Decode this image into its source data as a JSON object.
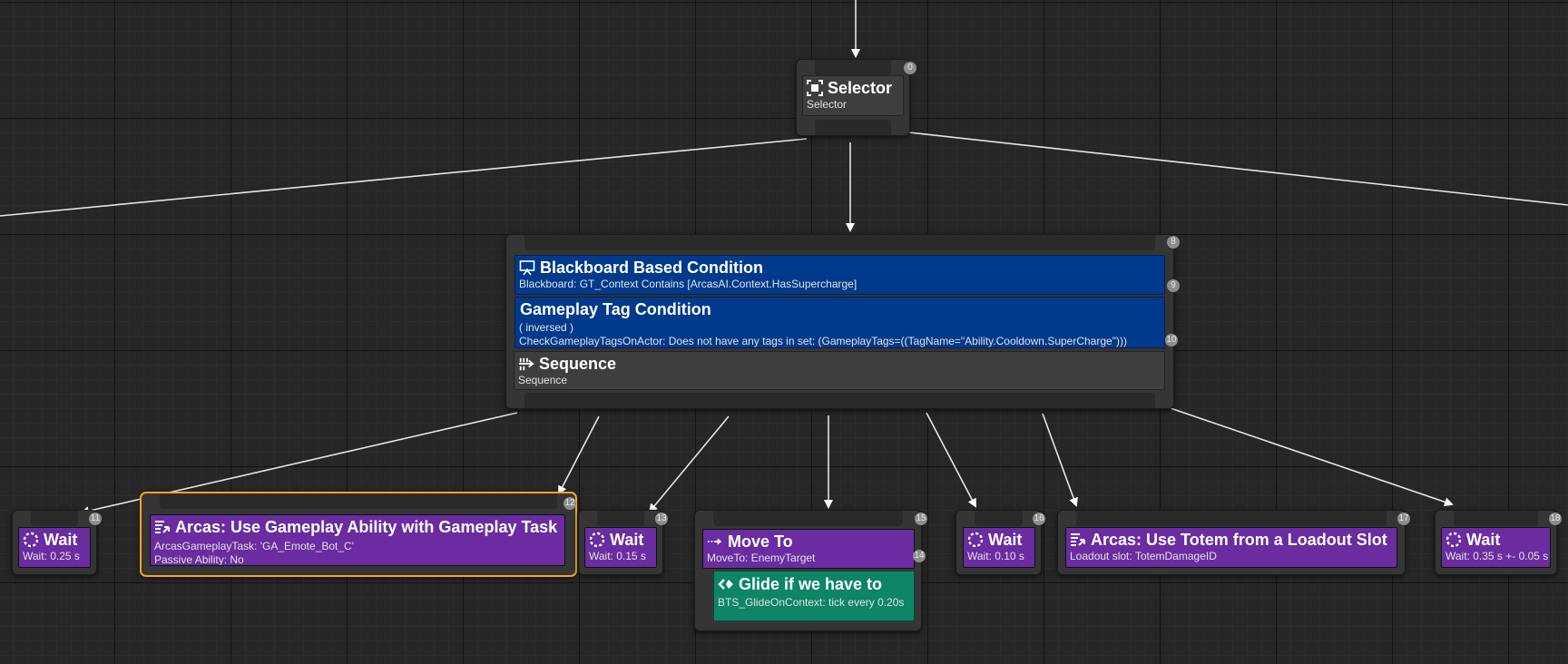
{
  "colors": {
    "background": "#262626",
    "task_purple": "#6a2ca0",
    "decorator_blue": "#003a8c",
    "composite_grey": "#3e3e3e",
    "service_teal": "#0d8566",
    "selection_outline": "#f5a623"
  },
  "selector": {
    "index": "0",
    "title": "Selector",
    "subtitle": "Selector",
    "icon": "selector-icon"
  },
  "sequence_node": {
    "index": "8",
    "decorators": [
      {
        "index": "9",
        "title": "Blackboard Based Condition",
        "line1": "Blackboard: GT_Context Contains [ArcasAI.Context.HasSupercharge]",
        "icon": "blackboard-icon"
      },
      {
        "index": "10",
        "title": "Gameplay Tag Condition",
        "line1": "( inversed )",
        "line2": "CheckGameplayTagsOnActor: Does not have any tags in set: (GameplayTags=((TagName=\"Ability.Cooldown.SuperCharge\")))"
      }
    ],
    "composite": {
      "title": "Sequence",
      "subtitle": "Sequence",
      "icon": "sequence-icon"
    }
  },
  "tasks": [
    {
      "index": "11",
      "title": "Wait",
      "lines": [
        "Wait: 0.25 s"
      ],
      "icon": "wait-icon"
    },
    {
      "index": "12",
      "title": "Arcas: Use Gameplay Ability with Gameplay Task",
      "lines": [
        "ArcasGameplayTask: 'GA_Emote_Bot_C'",
        "Passive Ability: No"
      ],
      "icon": "task-icon",
      "selected": true
    },
    {
      "index": "13",
      "title": "Wait",
      "lines": [
        "Wait: 0.15 s"
      ],
      "icon": "wait-icon"
    },
    {
      "index": "15",
      "title": "Move To",
      "lines": [
        "MoveTo: EnemyTarget"
      ],
      "icon": "move-to-icon"
    },
    {
      "index": "16",
      "title": "Wait",
      "lines": [
        "Wait: 0.10 s"
      ],
      "icon": "wait-icon"
    },
    {
      "index": "17",
      "title": "Arcas: Use Totem from a Loadout Slot",
      "lines": [
        "Loadout slot: TotemDamageID"
      ],
      "icon": "task-icon"
    },
    {
      "index": "18",
      "title": "Wait",
      "lines": [
        "Wait: 0.35 s +- 0.05 s"
      ],
      "icon": "wait-icon"
    }
  ],
  "service": {
    "index": "14",
    "title": "Glide if we have to",
    "line1": "BTS_GlideOnContext: tick every 0.20s",
    "icon": "service-icon"
  }
}
